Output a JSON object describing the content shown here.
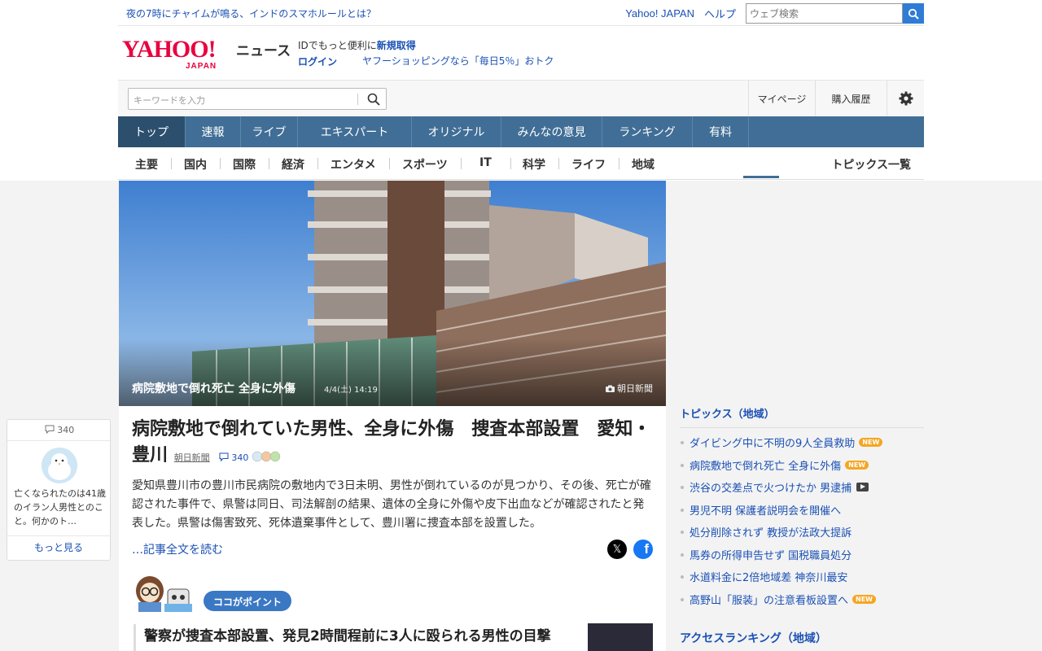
{
  "promo": {
    "headline": "夜の7時にチャイムが鳴る、インドのスマホルールとは？",
    "yahoo_japan_link": "Yahoo! JAPAN",
    "help_link": "ヘルプ",
    "web_search_placeholder": "ウェブ検索"
  },
  "header": {
    "logo_text": "YAHOO!",
    "logo_sub": "JAPAN",
    "service_name": "ニュース",
    "id_prompt": "IDでもっと便利に",
    "register_link": "新規取得",
    "login_link": "ログイン",
    "shopping_promo": "ヤフーショッピングなら「毎日5％」おトク"
  },
  "search": {
    "placeholder": "キーワードを入力",
    "mypage": "マイページ",
    "purchase_history": "購入履歴"
  },
  "main_nav": [
    "トップ",
    "速報",
    "ライブ",
    "エキスパート",
    "オリジナル",
    "みんなの意見",
    "ランキング",
    "有料"
  ],
  "sub_nav": [
    "主要",
    "国内",
    "国際",
    "経済",
    "エンタメ",
    "スポーツ",
    "IT",
    "科学",
    "ライフ",
    "地域"
  ],
  "topics_all": "トピックス一覧",
  "article": {
    "hero_caption": "病院敷地で倒れ死亡 全身に外傷",
    "hero_date": "4/4(土) 14:19",
    "hero_credit": "朝日新聞",
    "title": "病院敷地で倒れていた男性、全身に外傷　捜査本部設置　愛知・豊川",
    "source": "朝日新聞",
    "comment_count": "340",
    "body": "愛知県豊川市の豊川市民病院の敷地内で3日未明、男性が倒れているのが見つかり、その後、死亡が確認された事件で、県警は同日、司法解剖の結果、遺体の全身に外傷や皮下出血などが確認されたと発表した。県警は傷害致死、死体遺棄事件として、豊川署に捜査本部を設置した。",
    "read_more": "…記事全文を読む",
    "point_label": "ココがポイント",
    "point_title": "警察が捜査本部設置、発見2時間程前に3人に殴られる男性の目撃"
  },
  "comment_card": {
    "count": "340",
    "text": "亡くなられたのは41歳のイラン人男性とのこと。何かのト…",
    "more": "もっと見る"
  },
  "sidebar": {
    "topics_heading": "トピックス（地域）",
    "topics": [
      {
        "text": "ダイビング中に不明の9人全員救助",
        "badge": "NEW",
        "video": false
      },
      {
        "text": "病院敷地で倒れ死亡 全身に外傷",
        "badge": "NEW",
        "video": false
      },
      {
        "text": "渋谷の交差点で火つけたか 男逮捕",
        "badge": "",
        "video": true
      },
      {
        "text": "男児不明 保護者説明会を開催へ",
        "badge": "",
        "video": false
      },
      {
        "text": "処分削除されず 教授が法政大提訴",
        "badge": "",
        "video": false
      },
      {
        "text": "馬券の所得申告せず 国税職員処分",
        "badge": "",
        "video": false
      },
      {
        "text": "水道料金に2倍地域差 神奈川最安",
        "badge": "",
        "video": false
      },
      {
        "text": "高野山「服装」の注意看板設置へ",
        "badge": "NEW",
        "video": false
      }
    ],
    "ranking_heading": "アクセスランキング（地域）"
  },
  "colors": {
    "brand_red": "#e8033f",
    "nav_blue": "#406e96",
    "link_blue": "#1a50b4",
    "new_badge": "#f5a623"
  }
}
